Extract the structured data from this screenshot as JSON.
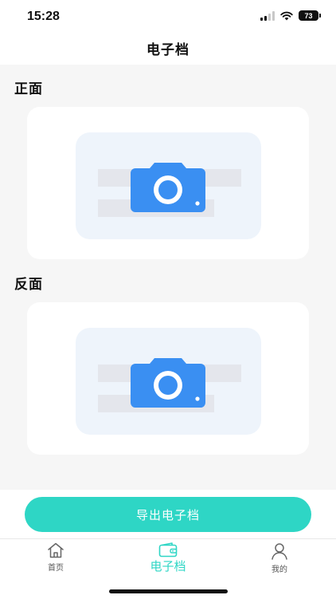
{
  "status": {
    "time": "15:28",
    "battery": "73"
  },
  "header": {
    "title": "电子档"
  },
  "sections": [
    {
      "label": "正面"
    },
    {
      "label": "反面"
    }
  ],
  "export_button": {
    "label": "导出电子档"
  },
  "tabbar": {
    "items": [
      {
        "label": "首页",
        "icon": "home-icon"
      },
      {
        "label": "电子档",
        "icon": "wallet-icon",
        "active": true
      },
      {
        "label": "我的",
        "icon": "user-icon"
      }
    ]
  },
  "colors": {
    "accent": "#2ed6c5",
    "camera": "#3a8ff2",
    "background": "#f6f6f6"
  }
}
